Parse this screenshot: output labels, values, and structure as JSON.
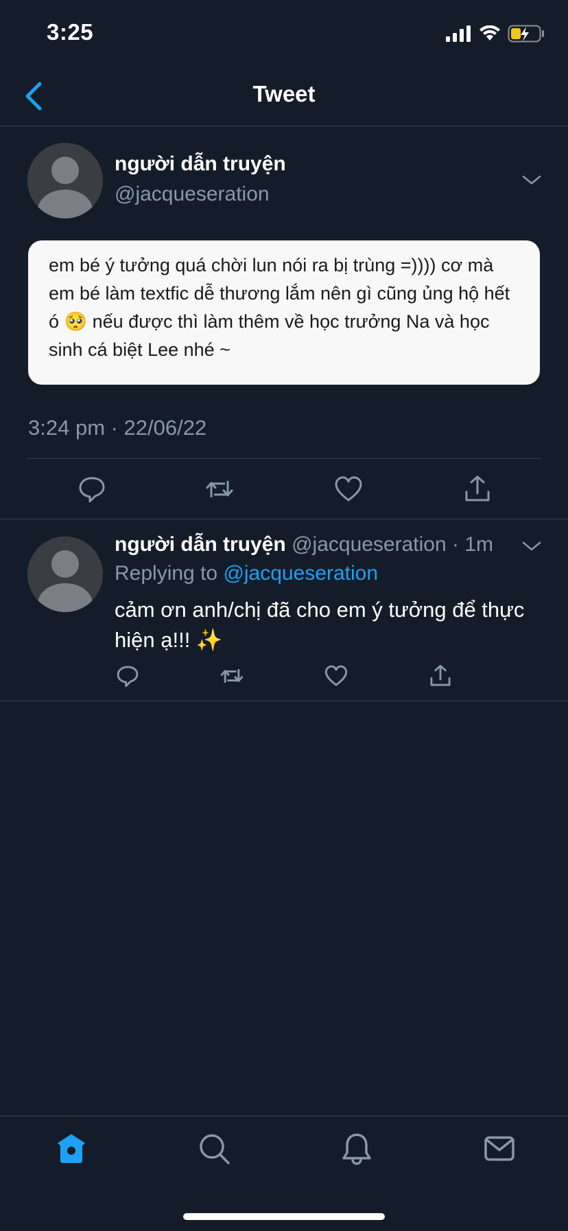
{
  "status_bar": {
    "time": "3:25"
  },
  "header": {
    "title": "Tweet"
  },
  "main_tweet": {
    "author_name": "người dẫn truyện",
    "author_handle": "@jacqueseration",
    "quote_text": "em bé ý tưởng quá chời lun nói ra bị trùng =)))) cơ mà em bé làm textfic dễ thương lắm nên gì cũng ủng hộ hết ó 🥺 nếu được thì làm thêm về học trưởng Na và học sinh cá biệt Lee nhé ~",
    "timestamp": "3:24 pm · 22/06/22",
    "actions": [
      "reply-icon",
      "retweet-icon",
      "like-icon",
      "share-icon"
    ]
  },
  "reply_tweet": {
    "author_name": "người dẫn truyện",
    "author_handle": "@jacqueseration",
    "time_ago": "1m",
    "replying_prefix": "Replying to",
    "replying_handle": "@jacqueseration",
    "text": "cảm ơn anh/chị đã cho em ý tưởng để thực hiện ạ!!! ✨"
  },
  "tab_bar": {
    "items": [
      "home-icon",
      "search-icon",
      "notifications-icon",
      "messages-icon"
    ],
    "active": "home-icon"
  },
  "colors": {
    "background": "#151c29",
    "accent": "#1da1f2",
    "secondary_text": "#8899a6",
    "divider": "#38444d"
  }
}
